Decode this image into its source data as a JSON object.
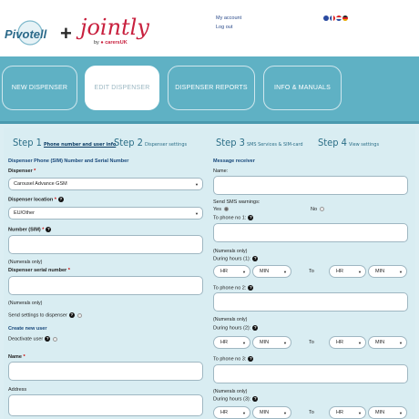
{
  "header": {
    "logo_plus": "+",
    "logo_jointly": "jointly",
    "logo_carers_by": "by",
    "logo_carers_brand": "carersUK",
    "my_account": "My account",
    "log_out": "Log out",
    "flag_colors": [
      "#2a4aa0",
      "#e0e0e0",
      "#d22",
      "#e8a800"
    ]
  },
  "nav": {
    "tabs": [
      "NEW DISPENSER",
      "EDIT DISPENSER",
      "DISPENSER REPORTS",
      "INFO & MANUALS"
    ],
    "active_index": 1,
    "band_color": "#5fb1c4"
  },
  "steps": [
    {
      "num": "Step 1",
      "label": "Phone number and user info"
    },
    {
      "num": "Step 2",
      "label": "Dispenser settings"
    },
    {
      "num": "Step 3",
      "label": "SMS Services & SIM-card"
    },
    {
      "num": "Step 4",
      "label": "View settings"
    }
  ],
  "left": {
    "section_title": "Dispenser Phone (SIM) Number and Serial Number",
    "dispenser_label": "Dispenser",
    "dispenser_value": "Carousel Advance GSM",
    "location_label": "Dispenser location",
    "location_value": "EU/Other",
    "number_label": "Number (SIM)",
    "numerals_only_1": "(Numerals only)",
    "serial_label": "Dispenser serial number",
    "numerals_only_2": "(Numerals only)",
    "send_settings_label": "Send settings to dispenser",
    "create_user_title": "Create new user",
    "deactivate_label": "Deactivate user",
    "name_label": "Name",
    "address_label": "Address",
    "required_mark": "*"
  },
  "right": {
    "section_title": "Message receiver",
    "name_label": "Name:",
    "sms_warnings_label": "Send SMS warnings:",
    "yes_label": "Yes",
    "no_label": "No",
    "phone1_label": "To phone no 1:",
    "numerals_only_a": "(Numerals only)",
    "during1_label": "During hours (1):",
    "phone2_label": "To phone no 2:",
    "numerals_only_b": "(Numerals only)",
    "during2_label": "During hours (2):",
    "phone3_label": "To phone no 3:",
    "numerals_only_c": "(Numerals only)",
    "during3_label": "During hours (3):",
    "hr": "HR",
    "min": "MIN",
    "to": "To"
  }
}
